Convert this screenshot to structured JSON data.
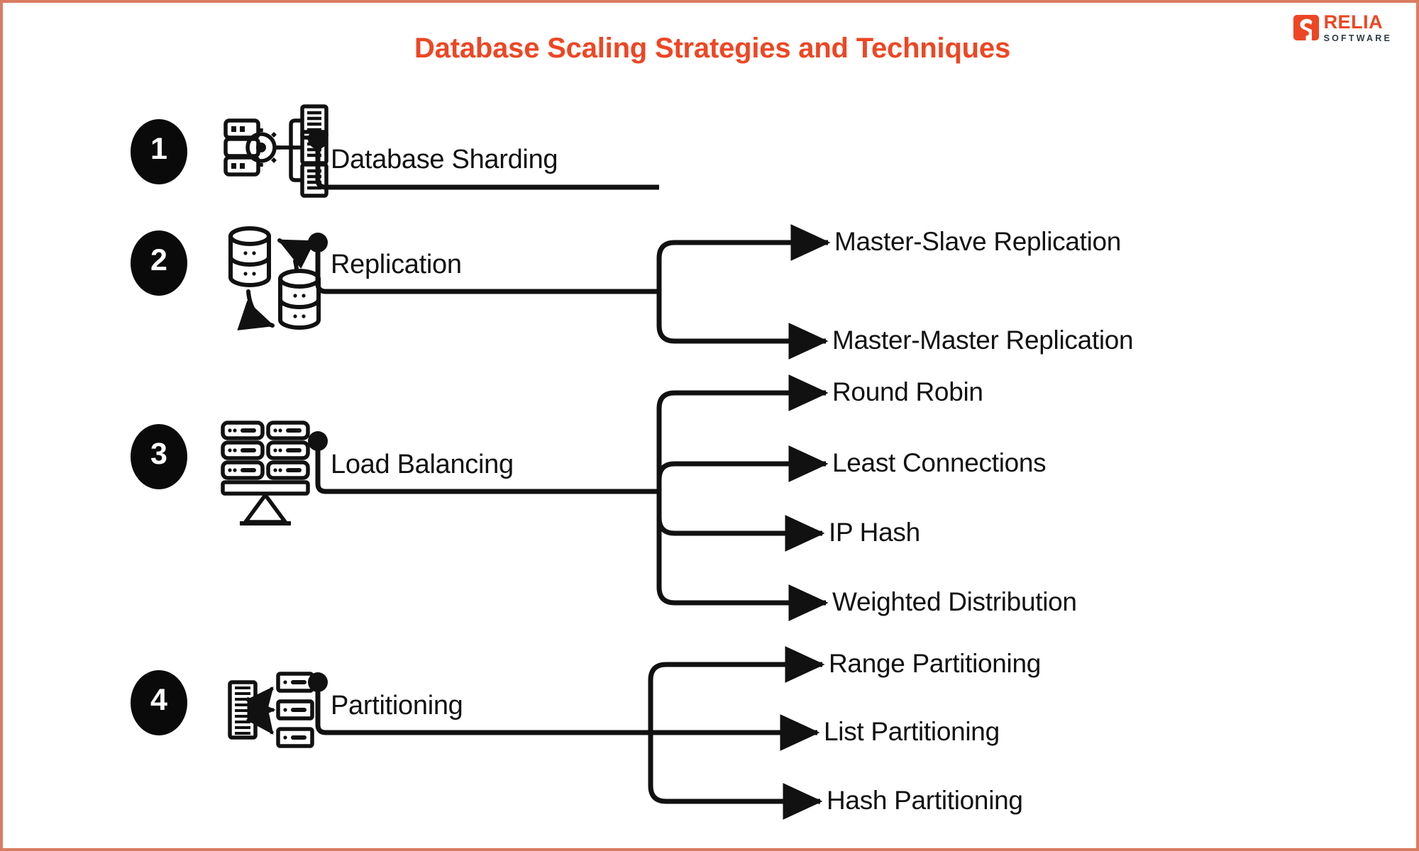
{
  "page": {
    "title": "Database Scaling Strategies and Techniques",
    "border_color": "#d97c62",
    "accent_color": "#ee4623",
    "line_color": "#111111",
    "background": "#ffffff"
  },
  "logo": {
    "mark": "relia-s-mark",
    "primary": "RELIA",
    "secondary": "SOFTWARE"
  },
  "items": [
    {
      "number": "1",
      "label": "Database Sharding",
      "icon": "database-sharding-icon",
      "children": []
    },
    {
      "number": "2",
      "label": "Replication",
      "icon": "database-replication-icon",
      "children": [
        "Master-Slave Replication",
        "Master-Master Replication"
      ]
    },
    {
      "number": "3",
      "label": "Load Balancing",
      "icon": "load-balancer-icon",
      "children": [
        "Round Robin",
        "Least Connections",
        "IP Hash",
        "Weighted Distribution"
      ]
    },
    {
      "number": "4",
      "label": "Partitioning",
      "icon": "table-partitioning-icon",
      "children": [
        "Range Partitioning",
        "List Partitioning",
        "Hash Partitioning"
      ]
    }
  ]
}
